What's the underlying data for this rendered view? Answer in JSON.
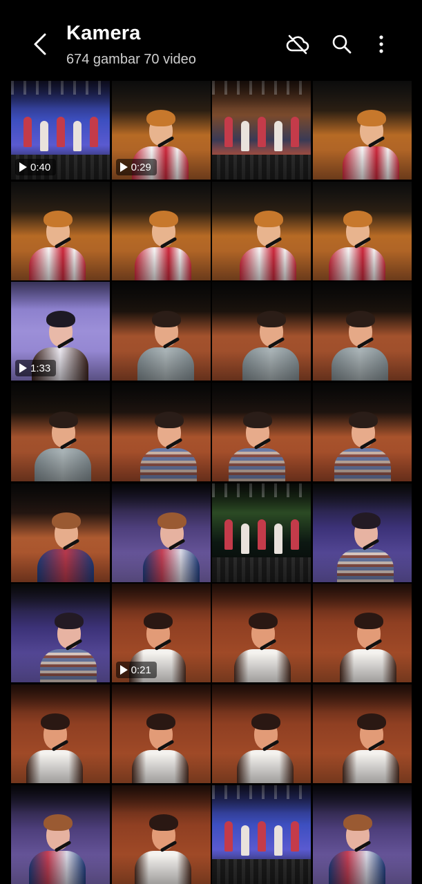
{
  "header": {
    "title": "Kamera",
    "subtitle": "674 gambar 70 video",
    "back_icon": "chevron-left-icon",
    "cloud_icon": "cloud-off-icon",
    "search_icon": "search-icon",
    "more_icon": "more-vertical-icon"
  },
  "colors": {
    "background": "#000000",
    "text_primary": "#ffffff",
    "text_secondary": "#cfcfcf"
  },
  "thumbnails": [
    {
      "type": "video",
      "duration": "0:40",
      "scene": "stage-wide-blue"
    },
    {
      "type": "video",
      "duration": "0:29",
      "scene": "orange-red-jacket"
    },
    {
      "type": "image",
      "scene": "stage-wide-group"
    },
    {
      "type": "image",
      "scene": "orange-red-jacket"
    },
    {
      "type": "image",
      "scene": "orange-red-jacket"
    },
    {
      "type": "image",
      "scene": "orange-red-jacket"
    },
    {
      "type": "image",
      "scene": "orange-red-jacket"
    },
    {
      "type": "image",
      "scene": "orange-red-jacket"
    },
    {
      "type": "video",
      "duration": "1:33",
      "scene": "purple-dark-jacket"
    },
    {
      "type": "image",
      "scene": "orange-grey-jacket"
    },
    {
      "type": "image",
      "scene": "orange-grey-jacket"
    },
    {
      "type": "image",
      "scene": "orange-grey-jacket"
    },
    {
      "type": "image",
      "scene": "orange-grey-jacket"
    },
    {
      "type": "image",
      "scene": "orange-striped"
    },
    {
      "type": "image",
      "scene": "orange-striped"
    },
    {
      "type": "image",
      "scene": "orange-striped"
    },
    {
      "type": "image",
      "scene": "orange-blue-jacket"
    },
    {
      "type": "image",
      "scene": "purple-blue-jacket"
    },
    {
      "type": "image",
      "scene": "stage-wide-green"
    },
    {
      "type": "image",
      "scene": "purple-striped"
    },
    {
      "type": "image",
      "scene": "purple-striped"
    },
    {
      "type": "video",
      "duration": "0:21",
      "scene": "orange-tank"
    },
    {
      "type": "image",
      "scene": "orange-tank"
    },
    {
      "type": "image",
      "scene": "orange-tank"
    },
    {
      "type": "image",
      "scene": "orange-tank"
    },
    {
      "type": "image",
      "scene": "orange-tank"
    },
    {
      "type": "image",
      "scene": "orange-tank"
    },
    {
      "type": "image",
      "scene": "orange-tank"
    },
    {
      "type": "image",
      "scene": "purple-blue-jacket"
    },
    {
      "type": "image",
      "scene": "orange-tank"
    },
    {
      "type": "image",
      "scene": "stage-wide-blue"
    },
    {
      "type": "image",
      "scene": "purple-blue-jacket"
    }
  ]
}
